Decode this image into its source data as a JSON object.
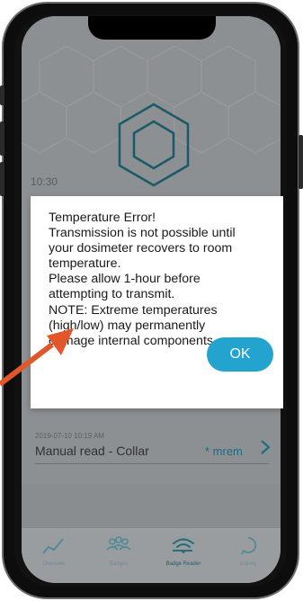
{
  "status": {
    "time_partial": "10:30"
  },
  "dialog": {
    "lines": [
      "Temperature Error!",
      "Transmission is not possible until",
      "your dosimeter recovers to room",
      "temperature.",
      "Please allow 1-hour before",
      "attempting to transmit.",
      "NOTE: Extreme temperatures",
      "(high/low) may permanently",
      "damage internal components."
    ],
    "ok_label": "OK"
  },
  "reading": {
    "date": "2019-07-10 10:19 AM",
    "title": "Manual read - Collar",
    "value": "* mrem"
  },
  "tabs": [
    {
      "label": "Overview",
      "icon": "chart-line-icon"
    },
    {
      "label": "Badges",
      "icon": "people-group-icon"
    },
    {
      "label": "Badge Reader",
      "icon": "wifi-icon",
      "active": true
    },
    {
      "label": "Activity",
      "icon": "activity-bubble-icon"
    }
  ],
  "colors": {
    "accent": "#22a4cf",
    "annotation_arrow": "#e2572a",
    "overlay_bg": "#8d9092"
  }
}
